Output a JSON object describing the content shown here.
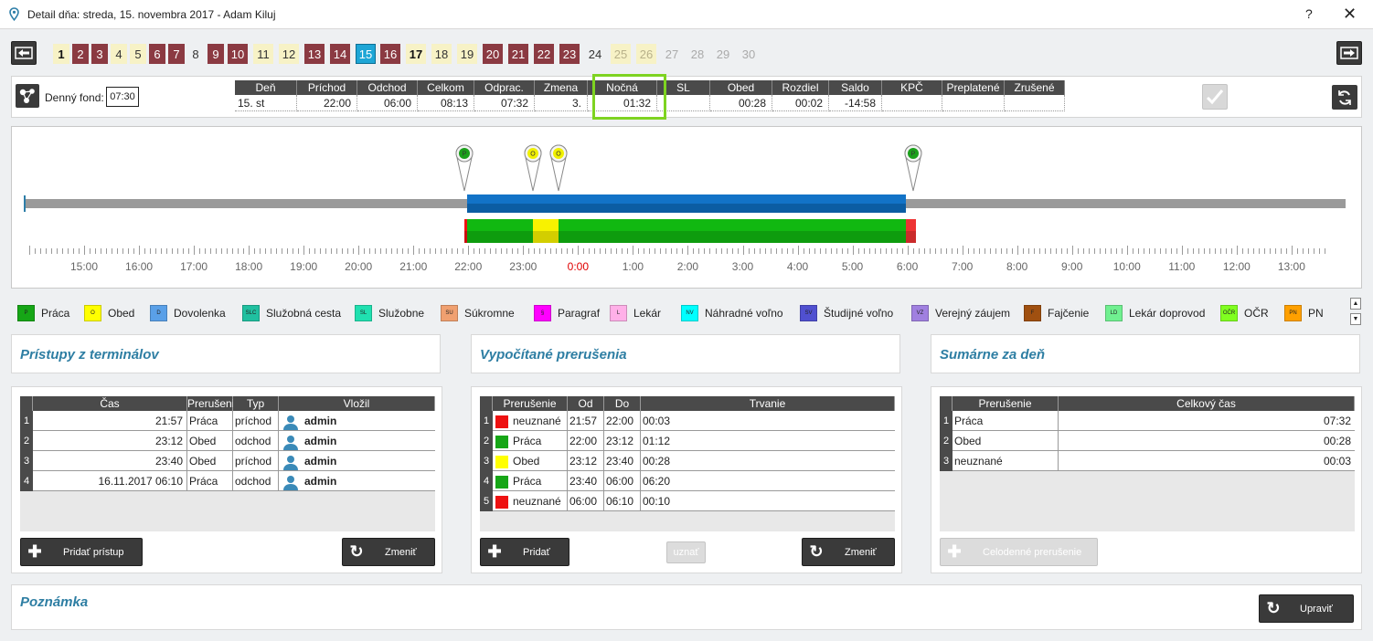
{
  "window": {
    "title": "Detail dňa: streda, 15. novembra 2017 -  Adam Kiluj",
    "help": "?",
    "close": "✕"
  },
  "days": [
    {
      "n": "1",
      "s": "crd"
    },
    {
      "n": "2",
      "s": "red"
    },
    {
      "n": "3",
      "s": "red"
    },
    {
      "n": "4",
      "s": "cream"
    },
    {
      "n": "5",
      "s": "cream"
    },
    {
      "n": "6",
      "s": "red"
    },
    {
      "n": "7",
      "s": "red"
    },
    {
      "n": "8",
      "s": "plain"
    },
    {
      "n": "9",
      "s": "red"
    },
    {
      "n": "10",
      "s": "red"
    },
    {
      "n": "11",
      "s": "cream"
    },
    {
      "n": "12",
      "s": "cream"
    },
    {
      "n": "13",
      "s": "red"
    },
    {
      "n": "14",
      "s": "red"
    },
    {
      "n": "15",
      "s": "cyan"
    },
    {
      "n": "16",
      "s": "red"
    },
    {
      "n": "17",
      "s": "crd"
    },
    {
      "n": "18",
      "s": "cream"
    },
    {
      "n": "19",
      "s": "cream"
    },
    {
      "n": "20",
      "s": "red"
    },
    {
      "n": "21",
      "s": "red"
    },
    {
      "n": "22",
      "s": "red"
    },
    {
      "n": "23",
      "s": "red"
    },
    {
      "n": "24",
      "s": "plain"
    },
    {
      "n": "25",
      "s": "fcream"
    },
    {
      "n": "26",
      "s": "fcream"
    },
    {
      "n": "27",
      "s": "grey"
    },
    {
      "n": "28",
      "s": "grey"
    },
    {
      "n": "29",
      "s": "grey"
    },
    {
      "n": "30",
      "s": "grey"
    }
  ],
  "fund": {
    "label": "Denný fond:",
    "value": "07:30"
  },
  "summary": {
    "headers": [
      "Deň",
      "Príchod",
      "Odchod",
      "Celkom",
      "Odprac.",
      "Zmena",
      "Nočná",
      "SL",
      "Obed",
      "Rozdiel",
      "Saldo",
      "KPČ",
      "Preplatené",
      "Zrušené"
    ],
    "values": [
      "15. st",
      "22:00",
      "06:00",
      "08:13",
      "07:32",
      "3.",
      "01:32",
      "",
      "00:28",
      "00:02",
      "-14:58",
      "",
      "",
      ""
    ],
    "highlight_color": "#7ed321"
  },
  "timeline": {
    "hours": [
      "15:00",
      "16:00",
      "17:00",
      "18:00",
      "19:00",
      "20:00",
      "21:00",
      "22:00",
      "23:00",
      "0:00",
      "1:00",
      "2:00",
      "3:00",
      "4:00",
      "5:00",
      "6:00",
      "7:00",
      "8:00",
      "9:00",
      "10:00",
      "11:00",
      "12:00",
      "13:00"
    ],
    "midnight_color": "#e00000",
    "pins": [
      {
        "label": "P",
        "color": "#1aa01a"
      },
      {
        "label": "O",
        "color": "#f0f000"
      },
      {
        "label": "O",
        "color": "#f0f000"
      },
      {
        "label": "P",
        "color": "#1aa01a"
      }
    ]
  },
  "legend": [
    {
      "code": "P",
      "label": "Práca",
      "color": "#16a616"
    },
    {
      "code": "O",
      "label": "Obed",
      "color": "#ffff00"
    },
    {
      "code": "D",
      "label": "Dovolenka",
      "color": "#5aa0e8"
    },
    {
      "code": "SLC",
      "label": "Služobná cesta",
      "color": "#20c0a0"
    },
    {
      "code": "SL",
      "label": "Služobne",
      "color": "#20e0b0"
    },
    {
      "code": "SU",
      "label": "Súkromne",
      "color": "#f0a070"
    },
    {
      "code": "§",
      "label": "Paragraf",
      "color": "#ff00ff"
    },
    {
      "code": "L",
      "label": "Lekár",
      "color": "#ffb0e8"
    },
    {
      "code": "NV",
      "label": "Náhradné voľno",
      "color": "#00ffff"
    },
    {
      "code": "SV",
      "label": "Študijné voľno",
      "color": "#5050d0"
    },
    {
      "code": "VZ",
      "label": "Verejný záujem",
      "color": "#a080e0"
    },
    {
      "code": "F",
      "label": "Fajčenie",
      "color": "#a05010"
    },
    {
      "code": "LD",
      "label": "Lekár doprovod",
      "color": "#70f090"
    },
    {
      "code": "OČR",
      "label": "OČR",
      "color": "#80ff20"
    },
    {
      "code": "PN",
      "label": "PN",
      "color": "#ffa000"
    }
  ],
  "terminals": {
    "title": "Prístupy z terminálov",
    "headers": [
      "Čas",
      "Prerušenie",
      "Typ",
      "Vložil"
    ],
    "rows": [
      [
        "21:57",
        "Práca",
        "príchod",
        "admin"
      ],
      [
        "23:12",
        "Obed",
        "odchod",
        "admin"
      ],
      [
        "23:40",
        "Obed",
        "príchod",
        "admin"
      ],
      [
        "16.11.2017 06:10",
        "Práca",
        "odchod",
        "admin"
      ]
    ],
    "add_button": "Pridať prístup",
    "change_button": "Zmeniť"
  },
  "interruptions": {
    "title": "Vypočítané prerušenia",
    "headers": [
      "Prerušenie",
      "Od",
      "Do",
      "Trvanie"
    ],
    "rows": [
      {
        "name": "neuznané",
        "from": "21:57",
        "to": "22:00",
        "dur": "00:03",
        "color": "#ee1111"
      },
      {
        "name": "Práca",
        "from": "22:00",
        "to": "23:12",
        "dur": "01:12",
        "color": "#16a616"
      },
      {
        "name": "Obed",
        "from": "23:12",
        "to": "23:40",
        "dur": "00:28",
        "color": "#ffff00"
      },
      {
        "name": "Práca",
        "from": "23:40",
        "to": "06:00",
        "dur": "06:20",
        "color": "#16a616"
      },
      {
        "name": "neuznané",
        "from": "06:00",
        "to": "06:10",
        "dur": "00:10",
        "color": "#ee1111"
      }
    ],
    "add_button": "Pridať",
    "approve_button": "uznať",
    "change_button": "Zmeniť"
  },
  "daily": {
    "title": "Sumárne za deň",
    "headers": [
      "Prerušenie",
      "Celkový čas"
    ],
    "rows": [
      [
        "Práca",
        "07:32"
      ],
      [
        "Obed",
        "00:28"
      ],
      [
        "neuznané",
        "00:03"
      ]
    ],
    "fullday_button": "Celodenné prerušenie"
  },
  "note": {
    "title": "Poznámka",
    "edit_button": "Upraviť"
  }
}
